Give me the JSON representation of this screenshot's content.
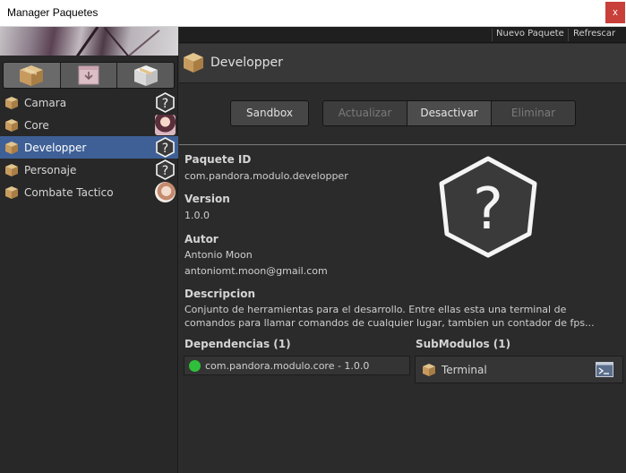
{
  "window": {
    "title": "Manager Paquetes",
    "close_label": "x"
  },
  "toolbar": {
    "new_package": "Nuevo Paquete",
    "refresh": "Refrescar"
  },
  "sidebar": {
    "tabs": [
      {
        "icon": "package-icon",
        "active": true
      },
      {
        "icon": "package-download-icon",
        "active": false
      },
      {
        "icon": "package-open-icon",
        "active": false
      }
    ],
    "items": [
      {
        "label": "Camara",
        "status": "unknown-icon",
        "selected": false
      },
      {
        "label": "Core",
        "status": "avatar",
        "selected": false
      },
      {
        "label": "Developper",
        "status": "unknown-icon",
        "selected": true
      },
      {
        "label": "Personaje",
        "status": "unknown-icon",
        "selected": false
      },
      {
        "label": "Combate Tactico",
        "status": "avatar",
        "selected": false
      }
    ]
  },
  "header": {
    "title": "Developper"
  },
  "actions": {
    "sandbox": "Sandbox",
    "update": "Actualizar",
    "deactivate": "Desactivar",
    "delete": "Eliminar"
  },
  "details": {
    "package_id_label": "Paquete ID",
    "package_id": "com.pandora.modulo.developper",
    "version_label": "Version",
    "version": "1.0.0",
    "author_label": "Autor",
    "author_name": "Antonio Moon",
    "author_email": "antoniomt.moon@gmail.com",
    "description_label": "Descripcion",
    "description_line1": "Conjunto de herramientas para el desarrollo. Entre ellas esta una terminal de",
    "description_line2": "comandos para llamar comandos de cualquier lugar, tambien un contador de fps..."
  },
  "dependencies": {
    "label": "Dependencias (1)",
    "items": [
      {
        "text": "com.pandora.modulo.core - 1.0.0",
        "status_color": "#2fbf3a"
      }
    ]
  },
  "submodules": {
    "label": "SubModulos (1)",
    "items": [
      {
        "text": "Terminal"
      }
    ]
  },
  "colors": {
    "selection": "#3e6096",
    "background": "#2b2b2b",
    "close_button": "#c9403a"
  }
}
